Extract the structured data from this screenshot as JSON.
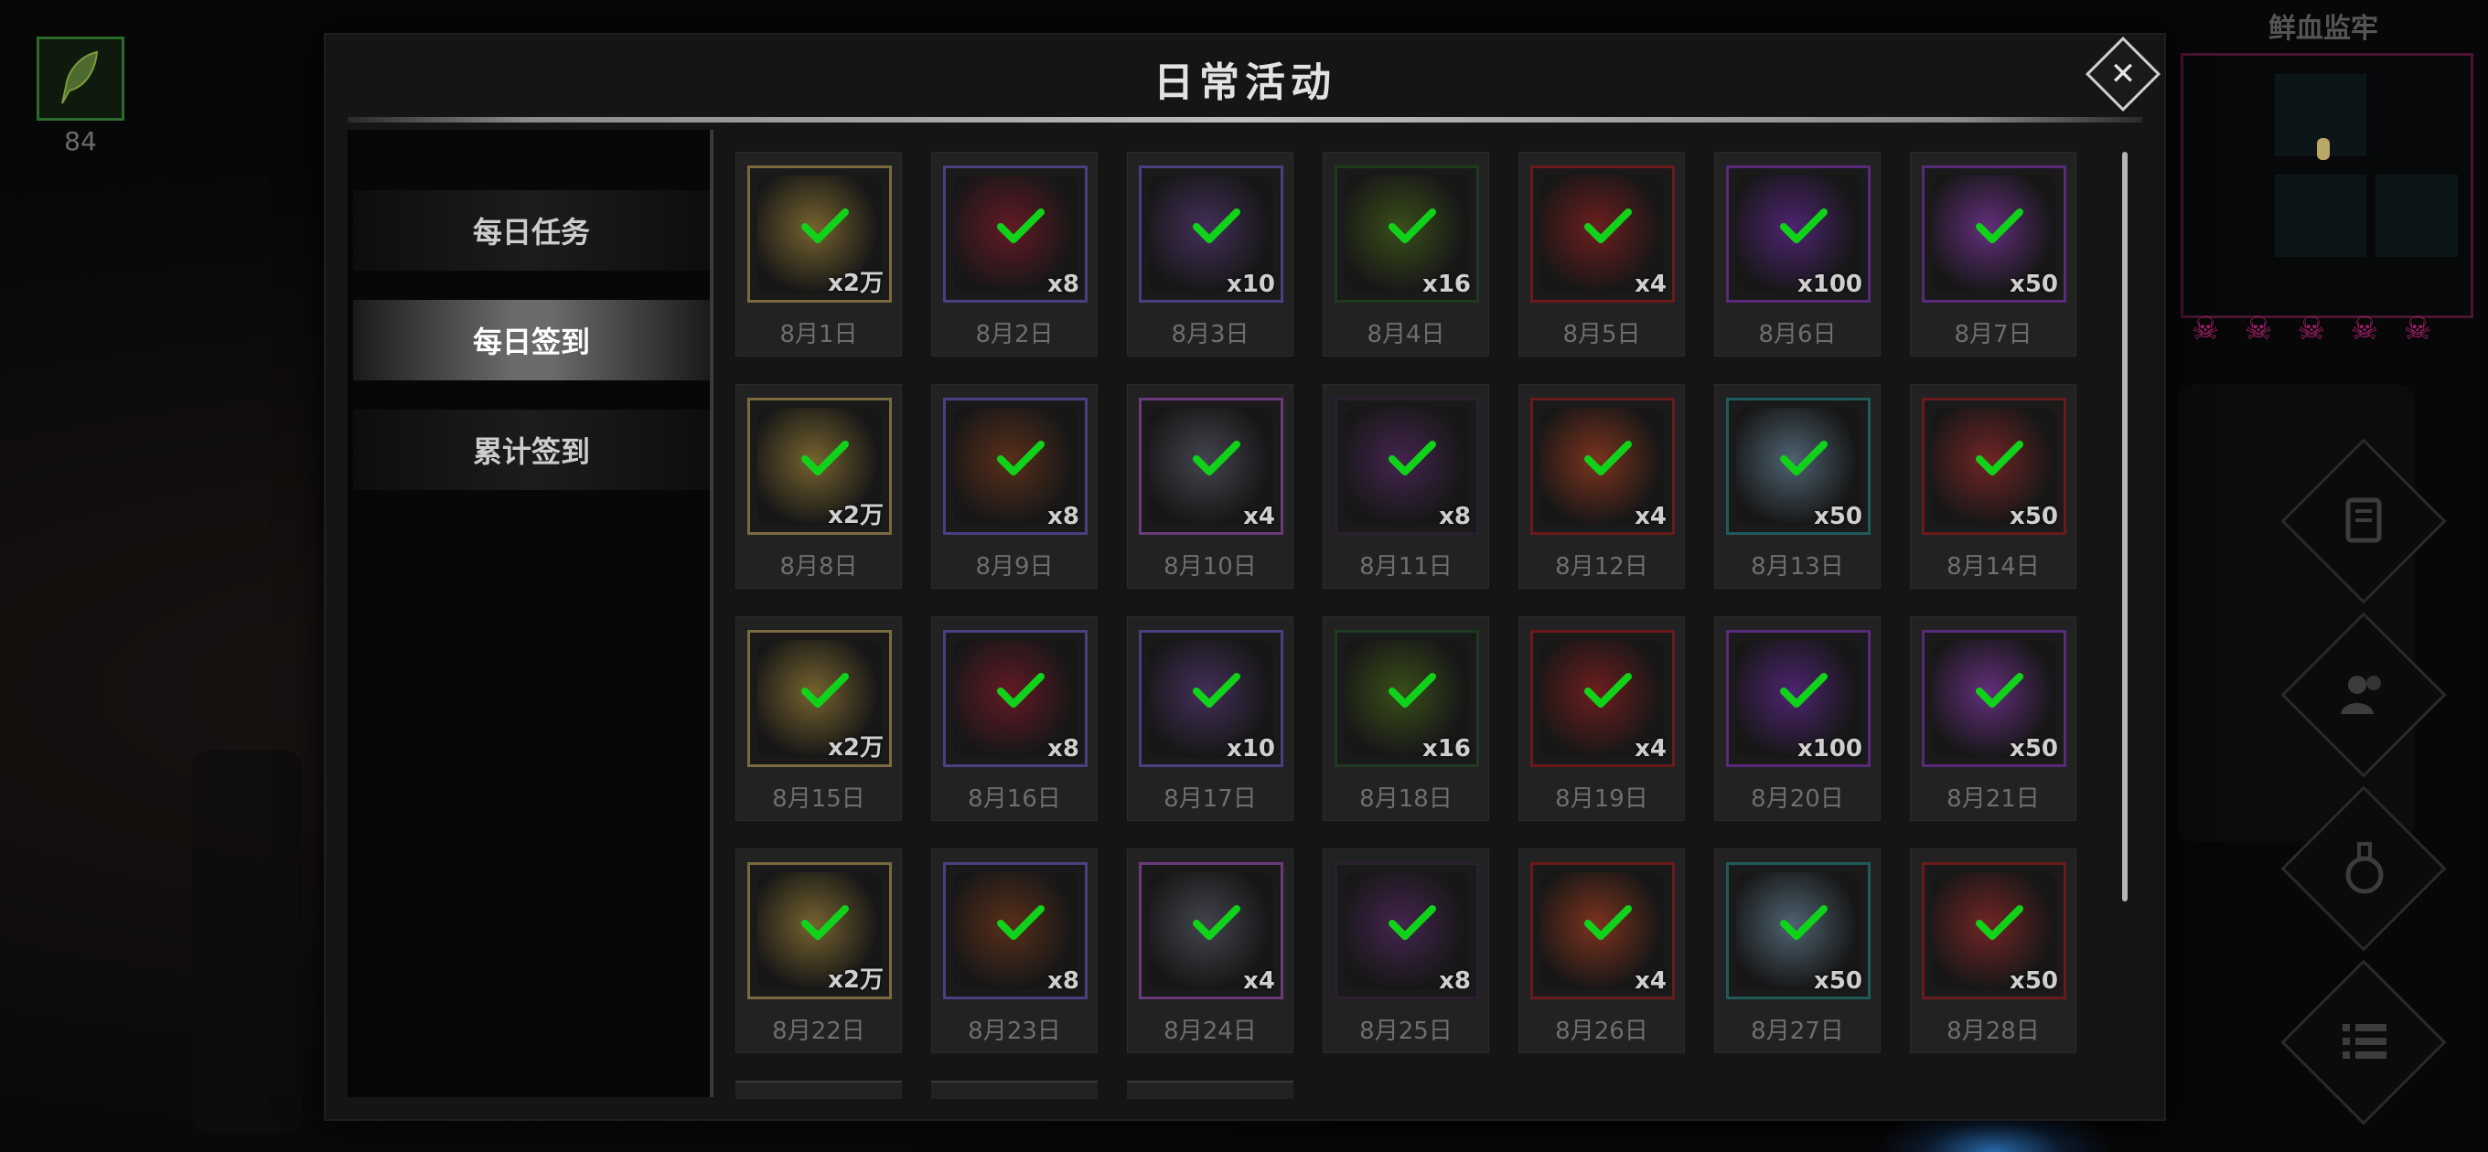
{
  "player_item": {
    "count": "84",
    "icon": "green-feather-icon"
  },
  "minimap": {
    "title": "鲜血监牢",
    "skulls": [
      "skull",
      "skull",
      "skull",
      "skull",
      "skull"
    ]
  },
  "side_buttons": [
    "scroll-icon",
    "party-icon",
    "potion-icon",
    "menu-list-icon"
  ],
  "modal": {
    "title": "日常活动",
    "close_icon": "close-icon",
    "tabs": [
      {
        "label": "每日任务",
        "active": false
      },
      {
        "label": "每日签到",
        "active": true
      },
      {
        "label": "累计签到",
        "active": false
      }
    ]
  },
  "checkin": {
    "days": [
      {
        "date": "8月1日",
        "qty": "x2万",
        "item": "gold-coins",
        "frame": "#7a6a40",
        "color": "#a88a3a",
        "claimed": true
      },
      {
        "date": "8月2日",
        "qty": "x8",
        "item": "red-crystal",
        "frame": "#4a3f80",
        "color": "#8a1a2a",
        "claimed": true
      },
      {
        "date": "8月3日",
        "qty": "x10",
        "item": "purple-shard",
        "frame": "#4a3f80",
        "color": "#5a3a7a",
        "claimed": true
      },
      {
        "date": "8月4日",
        "qty": "x16",
        "item": "green-feather",
        "frame": "#1f3a1f",
        "color": "#4a6a1a",
        "claimed": true
      },
      {
        "date": "8月5日",
        "qty": "x4",
        "item": "red-gem",
        "frame": "#6a1a1a",
        "color": "#9a2020",
        "claimed": true
      },
      {
        "date": "8月6日",
        "qty": "x100",
        "item": "violet-stone",
        "frame": "#5a2a7a",
        "color": "#6a2aa0",
        "claimed": true
      },
      {
        "date": "8月7日",
        "qty": "x50",
        "item": "purple-diamond",
        "frame": "#5a2a7a",
        "color": "#8a3ab0",
        "claimed": true
      },
      {
        "date": "8月8日",
        "qty": "x2万",
        "item": "gold-coins",
        "frame": "#7a6a40",
        "color": "#a88a3a",
        "claimed": true
      },
      {
        "date": "8月9日",
        "qty": "x8",
        "item": "rune-ore",
        "frame": "#4a3f80",
        "color": "#7a3a1a",
        "claimed": true
      },
      {
        "date": "8月10日",
        "qty": "x4",
        "item": "book",
        "frame": "#6a3a7a",
        "color": "#5a5a6a",
        "claimed": true
      },
      {
        "date": "8月11日",
        "qty": "x8",
        "item": "purple-feather",
        "frame": "#2a2030",
        "color": "#5a2a6a",
        "claimed": true
      },
      {
        "date": "8月12日",
        "qty": "x4",
        "item": "fire-gem",
        "frame": "#6a1a1a",
        "color": "#b04020",
        "claimed": true
      },
      {
        "date": "8月13日",
        "qty": "x50",
        "item": "ice-pyramid",
        "frame": "#1f5a5a",
        "color": "#6a8aa0",
        "claimed": true
      },
      {
        "date": "8月14日",
        "qty": "x50",
        "item": "flame-orb",
        "frame": "#6a1a1a",
        "color": "#a02a2a",
        "claimed": true
      },
      {
        "date": "8月15日",
        "qty": "x2万",
        "item": "gold-coins",
        "frame": "#7a6a40",
        "color": "#a88a3a",
        "claimed": true
      },
      {
        "date": "8月16日",
        "qty": "x8",
        "item": "red-crystal",
        "frame": "#4a3f80",
        "color": "#8a1a2a",
        "claimed": true
      },
      {
        "date": "8月17日",
        "qty": "x10",
        "item": "purple-shard",
        "frame": "#4a3f80",
        "color": "#5a3a7a",
        "claimed": true
      },
      {
        "date": "8月18日",
        "qty": "x16",
        "item": "green-feather",
        "frame": "#1f3a1f",
        "color": "#4a6a1a",
        "claimed": true
      },
      {
        "date": "8月19日",
        "qty": "x4",
        "item": "red-gem",
        "frame": "#6a1a1a",
        "color": "#9a2020",
        "claimed": true
      },
      {
        "date": "8月20日",
        "qty": "x100",
        "item": "violet-stone",
        "frame": "#5a2a7a",
        "color": "#6a2aa0",
        "claimed": true
      },
      {
        "date": "8月21日",
        "qty": "x50",
        "item": "purple-diamond",
        "frame": "#5a2a7a",
        "color": "#8a3ab0",
        "claimed": true
      },
      {
        "date": "8月22日",
        "qty": "x2万",
        "item": "gold-coins",
        "frame": "#7a6a40",
        "color": "#a88a3a",
        "claimed": true
      },
      {
        "date": "8月23日",
        "qty": "x8",
        "item": "rune-ore",
        "frame": "#4a3f80",
        "color": "#7a3a1a",
        "claimed": true
      },
      {
        "date": "8月24日",
        "qty": "x4",
        "item": "book",
        "frame": "#6a3a7a",
        "color": "#5a5a6a",
        "claimed": true
      },
      {
        "date": "8月25日",
        "qty": "x8",
        "item": "purple-feather",
        "frame": "#2a2030",
        "color": "#5a2a6a",
        "claimed": true
      },
      {
        "date": "8月26日",
        "qty": "x4",
        "item": "fire-gem",
        "frame": "#6a1a1a",
        "color": "#b04020",
        "claimed": true
      },
      {
        "date": "8月27日",
        "qty": "x50",
        "item": "ice-pyramid",
        "frame": "#1f5a5a",
        "color": "#6a8aa0",
        "claimed": true
      },
      {
        "date": "8月28日",
        "qty": "x50",
        "item": "flame-orb",
        "frame": "#6a1a1a",
        "color": "#a02a2a",
        "claimed": true
      }
    ]
  }
}
